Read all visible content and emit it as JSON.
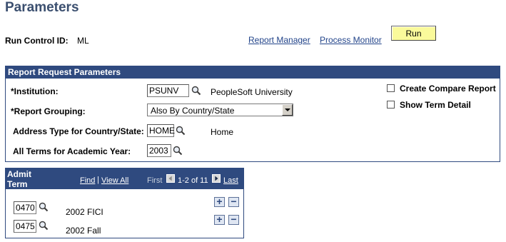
{
  "page": {
    "title": "Parameters"
  },
  "run_control": {
    "label": "Run Control ID:",
    "value": "ML"
  },
  "links": {
    "report_manager": "Report Manager",
    "process_monitor": "Process Monitor"
  },
  "run_button": {
    "label": "Run"
  },
  "report_params": {
    "header": "Report Request Parameters",
    "institution": {
      "label": "*Institution:",
      "value": "PSUNV",
      "description": "PeopleSoft University"
    },
    "report_grouping": {
      "label": "*Report Grouping:",
      "selected": "Also By Country/State"
    },
    "address_type": {
      "label": "Address Type for Country/State:",
      "value": "HOME",
      "description": "Home"
    },
    "all_terms": {
      "label": "All Terms for Academic Year:",
      "value": "2003"
    },
    "create_compare_report": {
      "label": "Create Compare Report",
      "checked": false
    },
    "show_term_detail": {
      "label": "Show Term Detail",
      "checked": false
    }
  },
  "admit_term_grid": {
    "header_line1": "Admit",
    "header_line2": "Term",
    "find": "Find",
    "separator": "|",
    "view_all": "View All",
    "first": "First",
    "range": "1-2 of 11",
    "last": "Last",
    "rows": [
      {
        "code": "0470",
        "description": "2002 FICI"
      },
      {
        "code": "0475",
        "description": "2002 Fall"
      }
    ]
  },
  "icons": {
    "lookup": "magnifier-icon",
    "add": "plus-icon",
    "delete": "minus-icon"
  },
  "colors": {
    "header_bg": "#2f4a7f",
    "title": "#3b4f6f",
    "run_button_bg": "#fafa9b",
    "link": "#22448a"
  }
}
